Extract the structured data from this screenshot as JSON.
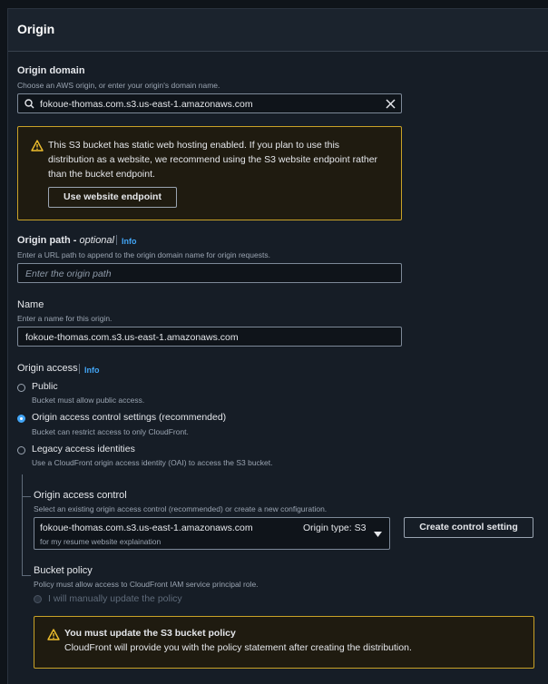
{
  "section": {
    "title": "Origin"
  },
  "origin_domain": {
    "label": "Origin domain",
    "description": "Choose an AWS origin, or enter your origin's domain name.",
    "value": "fokoue-thomas.com.s3.us-east-1.amazonaws.com",
    "search_icon": "search-icon",
    "clear_icon": "close-icon"
  },
  "website_warning": {
    "icon": "warning-icon",
    "line1": "This S3 bucket has static web hosting enabled. If you plan to use this",
    "line2": "distribution as a website, we recommend using the S3 website endpoint rather",
    "line3": "than the bucket endpoint.",
    "button_label": "Use website endpoint",
    "border_color": "#c9a227"
  },
  "origin_path": {
    "label": "Origin path - ",
    "optional": "optional",
    "info": "Info",
    "description": "Enter a URL path to append to the origin domain name for origin requests.",
    "placeholder": "Enter the origin path"
  },
  "name": {
    "label": "Name",
    "description": "Enter a name for this origin.",
    "value": "fokoue-thomas.com.s3.us-east-1.amazonaws.com"
  },
  "origin_access": {
    "label": "Origin access",
    "info": "Info",
    "selected": "oac",
    "options": [
      {
        "id": "public",
        "title": "Public",
        "description": "Bucket must allow public access."
      },
      {
        "id": "oac",
        "title": "Origin access control settings (recommended)",
        "description": "Bucket can restrict access to only CloudFront."
      },
      {
        "id": "oai",
        "title": "Legacy access identities",
        "description": "Use a CloudFront origin access identity (OAI) to access the S3 bucket."
      }
    ]
  },
  "oac": {
    "label": "Origin access control",
    "description": "Select an existing origin access control (recommended) or create a new configuration.",
    "select_value": "fokoue-thomas.com.s3.us-east-1.amazonaws.com",
    "select_sub": "for my resume website explaination",
    "select_tag": "Origin type: S3",
    "dropdown_icon": "caret-down-icon",
    "create_button": "Create control setting"
  },
  "bucket_policy": {
    "label": "Bucket policy",
    "description": "Policy must allow access to CloudFront IAM service principal role.",
    "option": "I will manually update the policy"
  },
  "policy_warning": {
    "icon": "warning-icon",
    "title": "You must update the S3 bucket policy",
    "text": "CloudFront will provide you with the policy statement after creating the distribution."
  },
  "colors": {
    "accent": "#42a5f5",
    "warning": "#c9a227",
    "background": "#161d26"
  }
}
